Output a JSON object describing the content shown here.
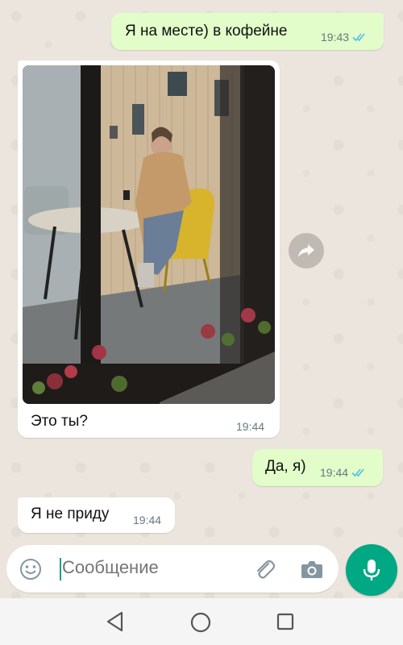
{
  "messages": [
    {
      "direction": "outgoing",
      "text": "Я на месте) в кофейне",
      "time": "19:43",
      "status": "read"
    },
    {
      "direction": "incoming",
      "type": "photo",
      "caption": "Это ты?",
      "time": "19:44"
    },
    {
      "direction": "outgoing",
      "text": "Да, я)",
      "time": "19:44",
      "status": "read"
    },
    {
      "direction": "incoming",
      "text": "Я не приду",
      "time": "19:44"
    }
  ],
  "composer": {
    "placeholder": "Сообщение",
    "emoji_icon": "emoji-icon",
    "attach_icon": "paperclip-icon",
    "camera_icon": "camera-icon",
    "send_icon": "microphone-icon"
  },
  "colors": {
    "outgoing_bubble": "#e2fdc9",
    "incoming_bubble": "#ffffff",
    "read_ticks": "#53bdeb",
    "accent": "#00a884",
    "chat_background": "#ece5dd"
  },
  "navigation": {
    "back_icon": "back-triangle-icon",
    "home_icon": "home-circle-icon",
    "recents_icon": "recents-square-icon"
  }
}
